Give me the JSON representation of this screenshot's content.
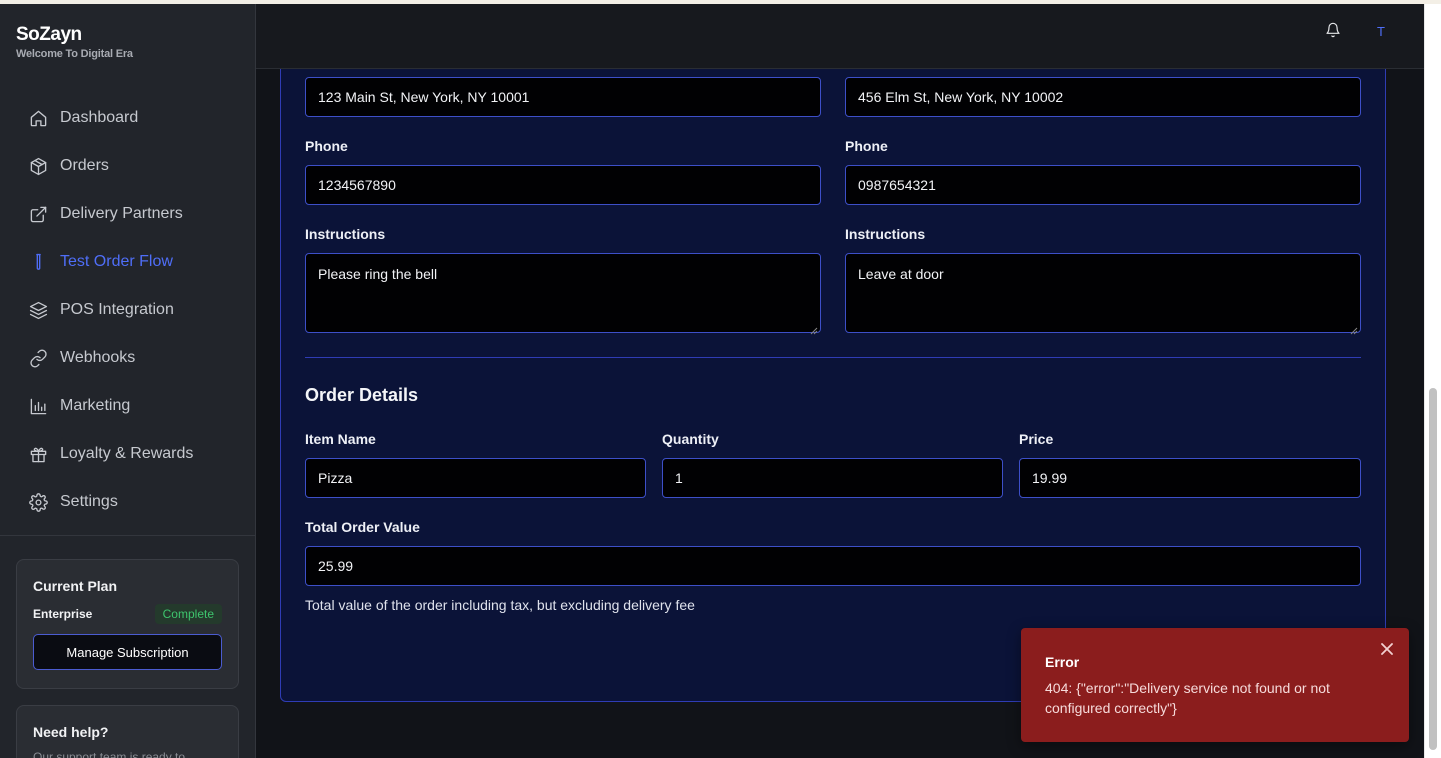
{
  "brand": {
    "name": "SoZayn",
    "tagline": "Welcome To Digital Era"
  },
  "sidebar": {
    "items": [
      {
        "label": "Dashboard",
        "icon": "home-icon",
        "active": false
      },
      {
        "label": "Orders",
        "icon": "package-icon",
        "active": false
      },
      {
        "label": "Delivery Partners",
        "icon": "external-link-icon",
        "active": false
      },
      {
        "label": "Test Order Flow",
        "icon": "test-tube-icon",
        "active": true
      },
      {
        "label": "POS Integration",
        "icon": "layers-icon",
        "active": false
      },
      {
        "label": "Webhooks",
        "icon": "link-icon",
        "active": false
      },
      {
        "label": "Marketing",
        "icon": "bar-chart-icon",
        "active": false
      },
      {
        "label": "Loyalty & Rewards",
        "icon": "gift-icon",
        "active": false
      },
      {
        "label": "Settings",
        "icon": "gear-icon",
        "active": false
      }
    ],
    "accent_color": "#4f6ef7"
  },
  "plan": {
    "title": "Current Plan",
    "name": "Enterprise",
    "status": "Complete",
    "status_color": "#3ec46d",
    "button": "Manage Subscription"
  },
  "help": {
    "title": "Need help?",
    "text": "Our support team is ready to"
  },
  "header": {
    "avatar_initial": "T",
    "bell_icon": "bell-icon"
  },
  "form": {
    "pickup": {
      "address": "123 Main St, New York, NY 10001",
      "phone_label": "Phone",
      "phone": "1234567890",
      "instructions_label": "Instructions",
      "instructions": "Please ring the bell"
    },
    "dropoff": {
      "address": "456 Elm St, New York, NY 10002",
      "phone_label": "Phone",
      "phone": "0987654321",
      "instructions_label": "Instructions",
      "instructions": "Leave at door"
    },
    "order": {
      "title": "Order Details",
      "item_label": "Item Name",
      "item": "Pizza",
      "quantity_label": "Quantity",
      "quantity": "1",
      "price_label": "Price",
      "price": "19.99",
      "total_label": "Total Order Value",
      "total": "25.99",
      "total_hint": "Total value of the order including tax, but excluding delivery fee"
    }
  },
  "toast": {
    "title": "Error",
    "message": "404: {\"error\":\"Delivery service not found or not configured correctly\"}",
    "background": "#8b1d1d"
  }
}
